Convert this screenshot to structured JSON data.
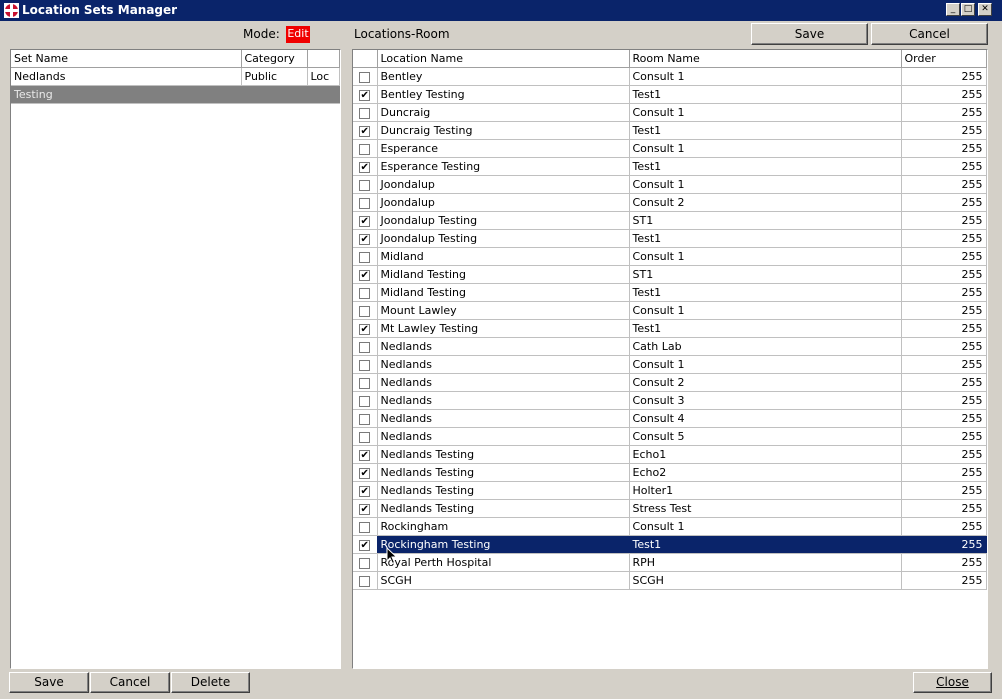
{
  "window": {
    "title": "Location Sets Manager",
    "minimize": "_",
    "maximize": "□",
    "close": "✕"
  },
  "mode": {
    "label": "Mode:",
    "value": "Edit"
  },
  "right_panel_title": "Locations-Room",
  "top_buttons": {
    "save": "Save",
    "cancel": "Cancel"
  },
  "sets": {
    "headers": [
      "Set Name",
      "Category",
      ""
    ],
    "rows": [
      {
        "name": "Nedlands",
        "category": "Public",
        "extra": "Loc"
      },
      {
        "name": "Testing",
        "category": "",
        "extra": ""
      }
    ]
  },
  "locations": {
    "headers": [
      "",
      "Location Name",
      "Room Name",
      "Order"
    ],
    "rows": [
      {
        "checked": false,
        "location": "Bentley",
        "room": "Consult 1",
        "order": "255"
      },
      {
        "checked": true,
        "location": "Bentley Testing",
        "room": "Test1",
        "order": "255"
      },
      {
        "checked": false,
        "location": "Duncraig",
        "room": "Consult 1",
        "order": "255"
      },
      {
        "checked": true,
        "location": "Duncraig Testing",
        "room": "Test1",
        "order": "255"
      },
      {
        "checked": false,
        "location": "Esperance",
        "room": "Consult 1",
        "order": "255"
      },
      {
        "checked": true,
        "location": "Esperance Testing",
        "room": "Test1",
        "order": "255"
      },
      {
        "checked": false,
        "location": "Joondalup",
        "room": "Consult 1",
        "order": "255"
      },
      {
        "checked": false,
        "location": "Joondalup",
        "room": "Consult 2",
        "order": "255"
      },
      {
        "checked": true,
        "location": "Joondalup Testing",
        "room": "ST1",
        "order": "255"
      },
      {
        "checked": true,
        "location": "Joondalup Testing",
        "room": "Test1",
        "order": "255"
      },
      {
        "checked": false,
        "location": "Midland",
        "room": "Consult 1",
        "order": "255"
      },
      {
        "checked": true,
        "location": "Midland Testing",
        "room": "ST1",
        "order": "255"
      },
      {
        "checked": false,
        "location": "Midland Testing",
        "room": "Test1",
        "order": "255"
      },
      {
        "checked": false,
        "location": "Mount Lawley",
        "room": "Consult 1",
        "order": "255"
      },
      {
        "checked": true,
        "location": "Mt Lawley Testing",
        "room": "Test1",
        "order": "255"
      },
      {
        "checked": false,
        "location": "Nedlands",
        "room": "Cath Lab",
        "order": "255"
      },
      {
        "checked": false,
        "location": "Nedlands",
        "room": "Consult 1",
        "order": "255"
      },
      {
        "checked": false,
        "location": "Nedlands",
        "room": "Consult 2",
        "order": "255"
      },
      {
        "checked": false,
        "location": "Nedlands",
        "room": "Consult 3",
        "order": "255"
      },
      {
        "checked": false,
        "location": "Nedlands",
        "room": "Consult 4",
        "order": "255"
      },
      {
        "checked": false,
        "location": "Nedlands",
        "room": "Consult 5",
        "order": "255"
      },
      {
        "checked": true,
        "location": "Nedlands Testing",
        "room": "Echo1",
        "order": "255"
      },
      {
        "checked": true,
        "location": "Nedlands Testing",
        "room": "Echo2",
        "order": "255"
      },
      {
        "checked": true,
        "location": "Nedlands Testing",
        "room": "Holter1",
        "order": "255"
      },
      {
        "checked": true,
        "location": "Nedlands Testing",
        "room": "Stress Test",
        "order": "255"
      },
      {
        "checked": false,
        "location": "Rockingham",
        "room": "Consult 1",
        "order": "255"
      },
      {
        "checked": true,
        "location": "Rockingham Testing",
        "room": "Test1",
        "order": "255",
        "selected": true
      },
      {
        "checked": false,
        "location": "Royal Perth Hospital",
        "room": "RPH",
        "order": "255"
      },
      {
        "checked": false,
        "location": "SCGH",
        "room": "SCGH",
        "order": "255"
      }
    ]
  },
  "bottom_buttons": {
    "save": "Save",
    "cancel": "Cancel",
    "delete": "Delete",
    "close": "Close"
  },
  "colors": {
    "titlebar": "#0a246a",
    "selection": "#0a246a",
    "mode_badge": "#f00000",
    "face": "#d4d0c8"
  }
}
